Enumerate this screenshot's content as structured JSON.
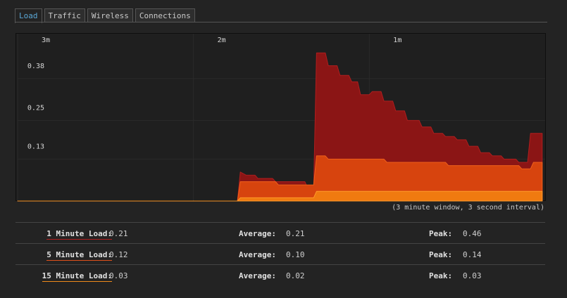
{
  "tabs": [
    {
      "label": "Load",
      "active": true
    },
    {
      "label": "Traffic",
      "active": false
    },
    {
      "label": "Wireless",
      "active": false
    },
    {
      "label": "Connections",
      "active": false
    }
  ],
  "caption": "(3 minute window, 3 second interval)",
  "chart_data": {
    "type": "area",
    "x_tick_labels": [
      "3m",
      "2m",
      "1m"
    ],
    "y_tick_labels": [
      "0.38",
      "0.25",
      "0.13"
    ],
    "y_ticks": [
      0.38,
      0.25,
      0.13
    ],
    "x_tick_seconds_ago": [
      180,
      120,
      60
    ],
    "ylim": [
      0,
      0.48
    ],
    "xlim_seconds_ago": [
      180,
      0
    ],
    "grid": true,
    "series": [
      {
        "name": "1 Minute Load",
        "color": "#8b1515",
        "edge": "#b01e1e",
        "points": [
          [
            180,
            0
          ],
          [
            105,
            0
          ],
          [
            104,
            0.09
          ],
          [
            102,
            0.08
          ],
          [
            99,
            0.08
          ],
          [
            98,
            0.07
          ],
          [
            93,
            0.07
          ],
          [
            92,
            0.06
          ],
          [
            82,
            0.06
          ],
          [
            81,
            0.04
          ],
          [
            79,
            0.04
          ],
          [
            78,
            0.46
          ],
          [
            75,
            0.46
          ],
          [
            74,
            0.42
          ],
          [
            71,
            0.42
          ],
          [
            70,
            0.39
          ],
          [
            67,
            0.39
          ],
          [
            66,
            0.37
          ],
          [
            64,
            0.37
          ],
          [
            63,
            0.33
          ],
          [
            60,
            0.33
          ],
          [
            59,
            0.34
          ],
          [
            56,
            0.34
          ],
          [
            55,
            0.31
          ],
          [
            52,
            0.31
          ],
          [
            51,
            0.28
          ],
          [
            48,
            0.28
          ],
          [
            47,
            0.25
          ],
          [
            43,
            0.25
          ],
          [
            42,
            0.23
          ],
          [
            39,
            0.23
          ],
          [
            38,
            0.21
          ],
          [
            35,
            0.21
          ],
          [
            34,
            0.2
          ],
          [
            31,
            0.2
          ],
          [
            30,
            0.19
          ],
          [
            27,
            0.19
          ],
          [
            26,
            0.17
          ],
          [
            23,
            0.17
          ],
          [
            22,
            0.15
          ],
          [
            19,
            0.15
          ],
          [
            18,
            0.14
          ],
          [
            15,
            0.14
          ],
          [
            14,
            0.13
          ],
          [
            10,
            0.13
          ],
          [
            9,
            0.12
          ],
          [
            6,
            0.12
          ],
          [
            5,
            0.21
          ],
          [
            1,
            0.21
          ]
        ]
      },
      {
        "name": "5 Minute Load",
        "color": "#d7440e",
        "edge": "#f0601a",
        "points": [
          [
            180,
            0
          ],
          [
            105,
            0
          ],
          [
            104,
            0.06
          ],
          [
            92,
            0.06
          ],
          [
            91,
            0.05
          ],
          [
            79,
            0.05
          ],
          [
            78,
            0.14
          ],
          [
            75,
            0.14
          ],
          [
            74,
            0.13
          ],
          [
            55,
            0.13
          ],
          [
            54,
            0.12
          ],
          [
            34,
            0.12
          ],
          [
            33,
            0.11
          ],
          [
            9,
            0.11
          ],
          [
            8,
            0.1
          ],
          [
            5,
            0.1
          ],
          [
            4,
            0.12
          ],
          [
            1,
            0.12
          ]
        ]
      },
      {
        "name": "15 Minute Load",
        "color": "#f07a10",
        "edge": "#ff9a2a",
        "points": [
          [
            180,
            0
          ],
          [
            105,
            0
          ],
          [
            104,
            0.01
          ],
          [
            79,
            0.01
          ],
          [
            78,
            0.03
          ],
          [
            1,
            0.03
          ]
        ]
      }
    ]
  },
  "stats": [
    {
      "label": "1 Minute Load:",
      "value": "0.21",
      "avg_label": "Average:",
      "avg": "0.21",
      "peak_label": "Peak:",
      "peak": "0.46",
      "underline": "#b01e1e"
    },
    {
      "label": "5 Minute Load:",
      "value": "0.12",
      "avg_label": "Average:",
      "avg": "0.10",
      "peak_label": "Peak:",
      "peak": "0.14",
      "underline": "#e0501a"
    },
    {
      "label": "15 Minute Load:",
      "value": "0.03",
      "avg_label": "Average:",
      "avg": "0.02",
      "peak_label": "Peak:",
      "peak": "0.03",
      "underline": "#f08a1a"
    }
  ]
}
